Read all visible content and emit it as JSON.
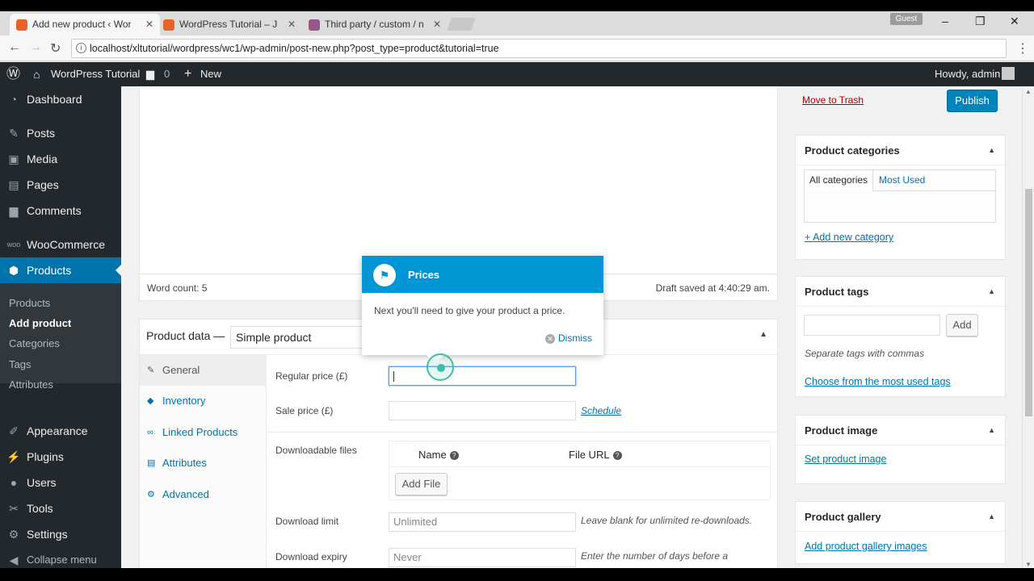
{
  "browser": {
    "tabs": [
      {
        "label": "Add new product ‹ Word",
        "favicon_color": "#e8632a"
      },
      {
        "label": "WordPress Tutorial – Jus",
        "favicon_color": "#e8632a"
      },
      {
        "label": "Third party / custom / n",
        "favicon_color": "#96588a"
      }
    ],
    "profile": "Guest",
    "url": "localhost/xltutorial/wordpress/wc1/wp-admin/post-new.php?post_type=product&tutorial=true",
    "window_controls": [
      "–",
      "❐",
      "✕"
    ]
  },
  "adminbar": {
    "site_name": "WordPress Tutorial",
    "comments_count": "0",
    "new_label": "New",
    "howdy": "Howdy, admin"
  },
  "sidebar": {
    "items": [
      {
        "label": "Dashboard",
        "icon": "dashboard-icon"
      },
      {
        "label": "Posts",
        "icon": "pin-icon"
      },
      {
        "label": "Media",
        "icon": "media-icon"
      },
      {
        "label": "Pages",
        "icon": "pages-icon"
      },
      {
        "label": "Comments",
        "icon": "comment-icon"
      },
      {
        "label": "WooCommerce",
        "icon": "woo-icon"
      },
      {
        "label": "Products",
        "icon": "box-icon"
      },
      {
        "label": "Appearance",
        "icon": "brush-icon"
      },
      {
        "label": "Plugins",
        "icon": "plug-icon"
      },
      {
        "label": "Users",
        "icon": "user-icon"
      },
      {
        "label": "Tools",
        "icon": "wrench-icon"
      },
      {
        "label": "Settings",
        "icon": "settings-icon"
      },
      {
        "label": "Collapse menu",
        "icon": "collapse-icon"
      }
    ],
    "submenu": [
      "Products",
      "Add product",
      "Categories",
      "Tags",
      "Attributes"
    ]
  },
  "editor": {
    "word_count": "Word count: 5",
    "draft_saved": "Draft saved at 4:40:29 am."
  },
  "product_data": {
    "title": "Product data —",
    "type": "Simple product",
    "tabs": [
      "General",
      "Inventory",
      "Linked Products",
      "Attributes",
      "Advanced"
    ],
    "regular_price_label": "Regular price (£)",
    "sale_price_label": "Sale price (£)",
    "schedule": "Schedule",
    "downloadable_files_label": "Downloadable files",
    "col_name": "Name",
    "col_file_url": "File URL",
    "add_file": "Add File",
    "download_limit_label": "Download limit",
    "download_limit_placeholder": "Unlimited",
    "download_limit_note": "Leave blank for unlimited re-downloads.",
    "download_expiry_label": "Download expiry",
    "download_expiry_placeholder": "Never",
    "download_expiry_note": "Enter the number of days before a download link expires, or leave blank."
  },
  "tour": {
    "title": "Prices",
    "body": "Next you'll need to give your product a price.",
    "dismiss": "Dismiss"
  },
  "right": {
    "move_to_trash": "Move to Trash",
    "publish": "Publish",
    "categories": {
      "title": "Product categories",
      "tab_all": "All categories",
      "tab_most_used": "Most Used",
      "add_new": "+ Add new category"
    },
    "tags": {
      "title": "Product tags",
      "add": "Add",
      "hint": "Separate tags with commas",
      "choose": "Choose from the most used tags"
    },
    "image": {
      "title": "Product image",
      "set": "Set product image"
    },
    "gallery": {
      "title": "Product gallery",
      "add": "Add product gallery images"
    }
  },
  "colors": {
    "accent": "#0073aa",
    "tour": "#0096d6",
    "adminbar": "#23282d"
  }
}
